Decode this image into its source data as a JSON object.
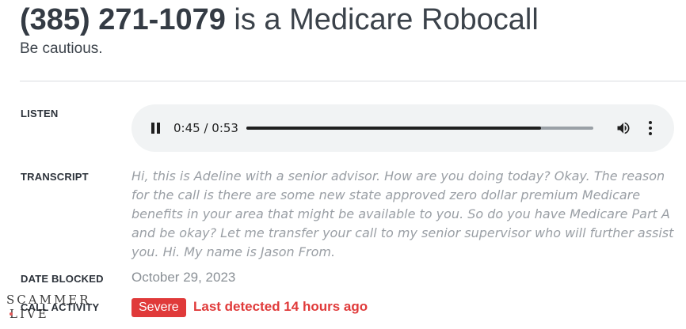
{
  "header": {
    "phone_number": "(385) 271-1079",
    "title_suffix": " is a Medicare Robocall",
    "subtitle": "Be cautious."
  },
  "sections": {
    "listen_label": "LISTEN",
    "transcript_label": "TRANSCRIPT",
    "date_blocked_label": "DATE BLOCKED",
    "call_activity_label": "CALL ACTIVITY"
  },
  "audio_player": {
    "time_display": "0:45 / 0:53",
    "progress": 0.849,
    "state": "playing",
    "icons": [
      "pause-icon",
      "volume-icon",
      "more-vert-icon"
    ]
  },
  "transcript": "Hi, this is Adeline with a senior advisor. How are you doing today? Okay. The reason for the call is there are some new state approved zero dollar premium Medicare benefits in your area that might be available to you. So do you have Medicare Part A and be okay? Let me transfer your call to my senior supervisor who will further assist you. Hi. My name is Jason From.",
  "date_blocked": "October 29, 2023",
  "call_activity": {
    "severity": "Severe",
    "last_detected": "Last detected 14 hours ago"
  },
  "watermark": {
    "line1": "SCAMMER",
    "line2": "LIVE"
  },
  "colors": {
    "accent_red": "#e03a3a",
    "player_bg": "#f1f3f4",
    "muted_text": "#9a9fa5"
  }
}
